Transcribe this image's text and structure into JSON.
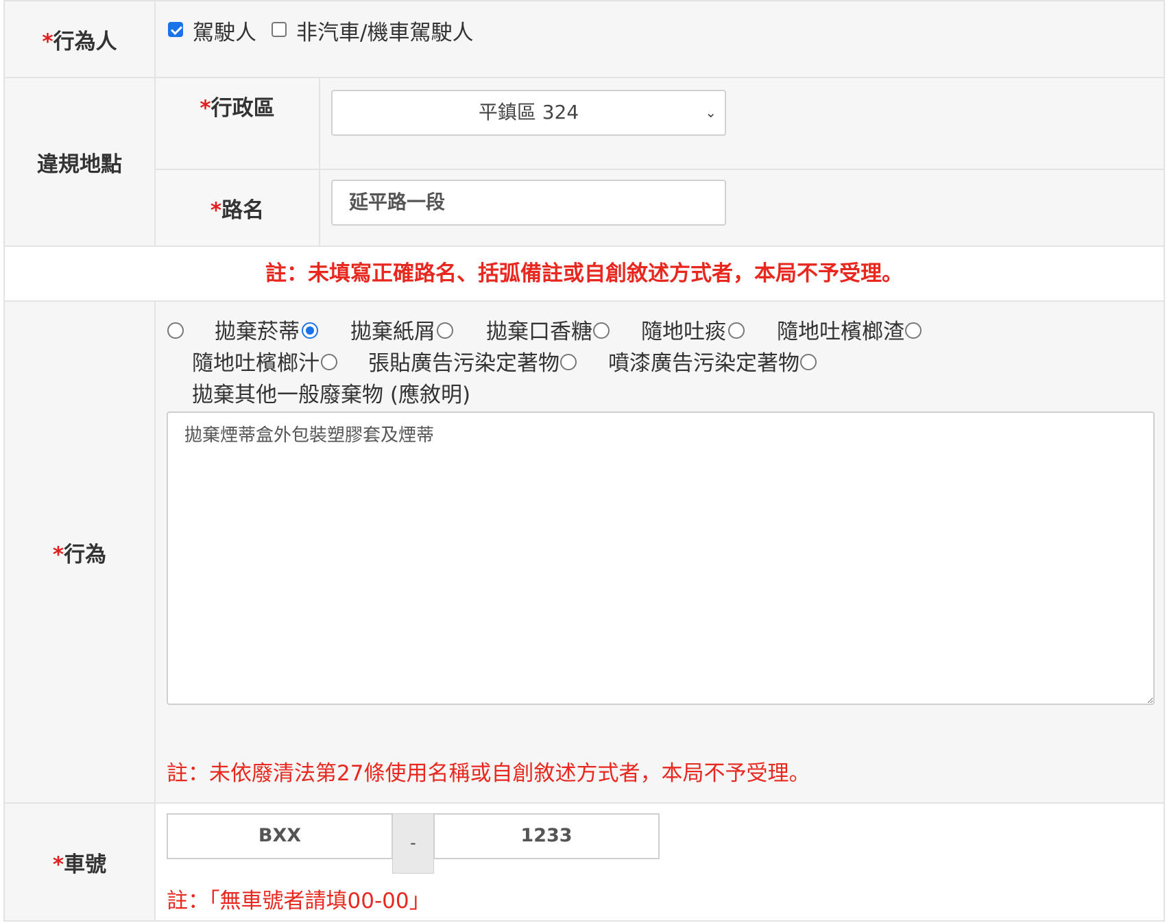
{
  "actor": {
    "label": "行為人",
    "required_mark": "*",
    "options": [
      {
        "label": "駕駛人",
        "checked": true
      },
      {
        "label": "非汽車/機車駕駛人",
        "checked": false
      }
    ]
  },
  "location": {
    "label": "違規地點",
    "district": {
      "label": "行政區",
      "required_mark": "*",
      "selected": "平鎮區 324"
    },
    "road": {
      "label": "路名",
      "required_mark": "*",
      "value": "延平路一段"
    },
    "note": "註：未填寫正確路名、括弧備註或自創敘述方式者，本局不予受理。"
  },
  "behavior": {
    "label": "行為",
    "required_mark": "*",
    "options": [
      {
        "label": "拋棄菸蒂",
        "checked": false
      },
      {
        "label": "拋棄紙屑",
        "checked": true
      },
      {
        "label": "拋棄口香糖",
        "checked": false
      },
      {
        "label": "隨地吐痰",
        "checked": false
      },
      {
        "label": "隨地吐檳榔渣",
        "checked": false
      },
      {
        "label": "隨地吐檳榔汁",
        "checked": false
      },
      {
        "label": "張貼廣告污染定著物",
        "checked": false
      },
      {
        "label": "噴漆廣告污染定著物",
        "checked": false
      },
      {
        "label": "拋棄其他一般廢棄物 (應敘明)",
        "checked": false
      }
    ],
    "description": "拋棄煙蒂盒外包裝塑膠套及煙蒂",
    "note": "註：未依廢清法第27條使用名稱或自創敘述方式者，本局不予受理。"
  },
  "plate": {
    "label": "車號",
    "required_mark": "*",
    "part1": "BXX",
    "separator": "-",
    "part2": "1233",
    "note": "註：「無車號者請填00-00」"
  },
  "colors": {
    "required": "#e02020",
    "note": "#e8271f",
    "accent": "#1a73e8"
  }
}
